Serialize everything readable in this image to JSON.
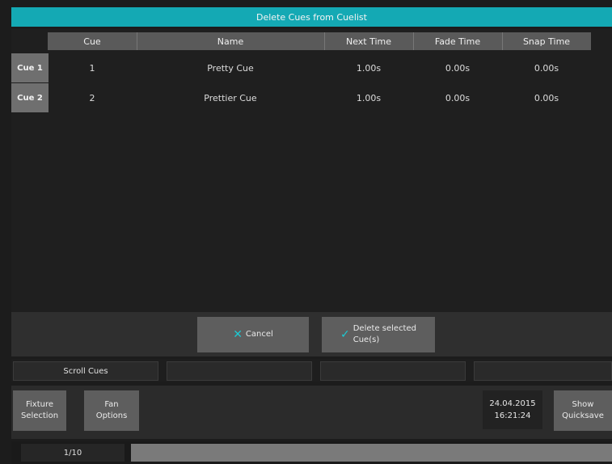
{
  "window": {
    "title": "Delete Cues from Cuelist"
  },
  "table": {
    "columns": [
      "Cue",
      "Name",
      "Next Time",
      "Fade Time",
      "Snap Time"
    ],
    "rows": [
      {
        "header": "Cue 1",
        "cue": "1",
        "name": "Pretty Cue",
        "next_time": "1.00s",
        "fade_time": "0.00s",
        "snap_time": "0.00s"
      },
      {
        "header": "Cue 2",
        "cue": "2",
        "name": "Prettier Cue",
        "next_time": "1.00s",
        "fade_time": "0.00s",
        "snap_time": "0.00s"
      }
    ]
  },
  "actions": {
    "cancel_label": "Cancel",
    "delete_line1": "Delete selected",
    "delete_line2": "Cue(s)",
    "cancel_icon": "x-icon",
    "delete_icon": "check-icon"
  },
  "scroll": {
    "label": "Scroll Cues"
  },
  "bottom": {
    "fixture_line1": "Fixture",
    "fixture_line2": "Selection",
    "fan_line1": "Fan",
    "fan_line2": "Options",
    "date": "24.04.2015",
    "time": "16:21:24",
    "show_line1": "Show",
    "show_line2": "Quicksave"
  },
  "pager": {
    "label": "1/10"
  },
  "colors": {
    "accent": "#14a9b4",
    "button": "#5e5e5e"
  }
}
